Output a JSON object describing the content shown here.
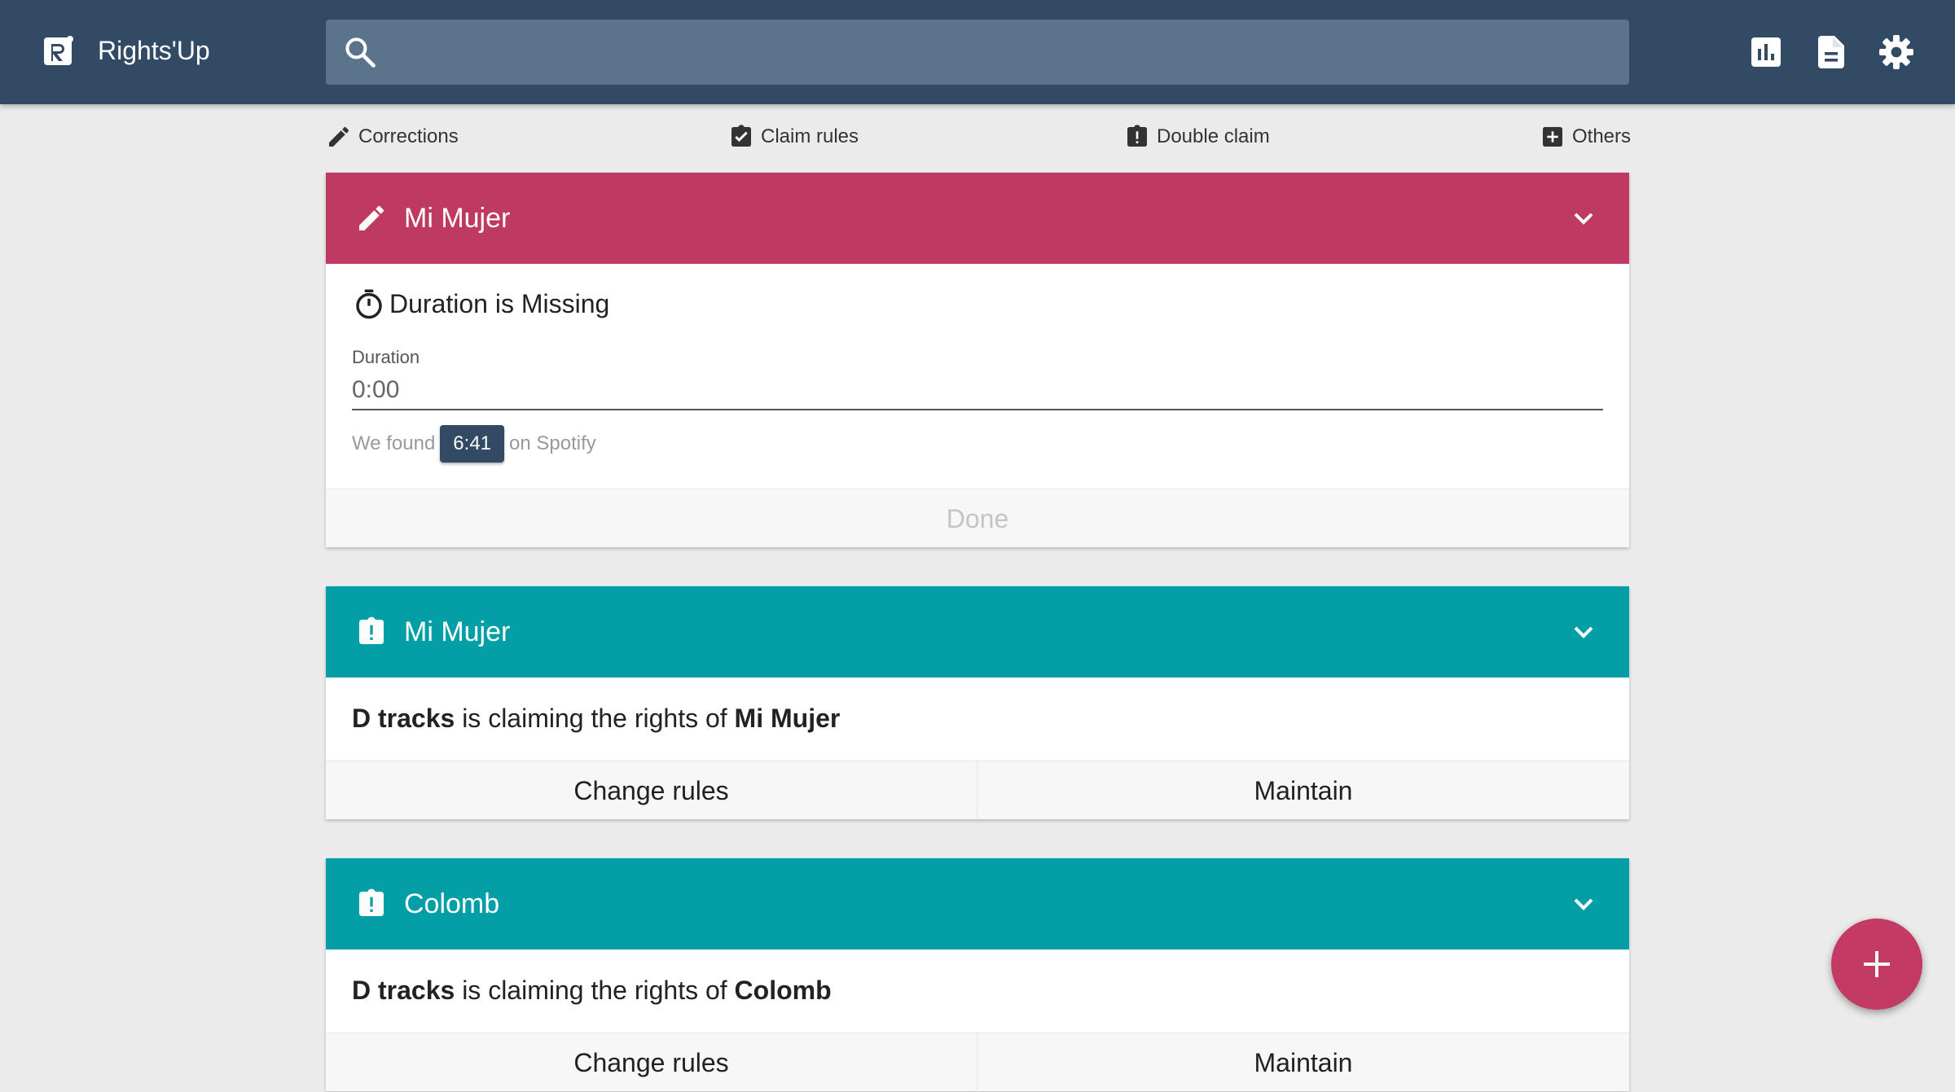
{
  "app": {
    "name": "Rights'Up"
  },
  "search": {
    "placeholder": ""
  },
  "filters": [
    {
      "label": "Corrections",
      "icon": "pencil-icon"
    },
    {
      "label": "Claim rules",
      "icon": "clipboard-check-icon"
    },
    {
      "label": "Double claim",
      "icon": "clipboard-alert-icon"
    },
    {
      "label": "Others",
      "icon": "plus-box-icon"
    }
  ],
  "colors": {
    "appbar": "#324a63",
    "correction": "#bf3a63",
    "claim": "#049ea7",
    "fab": "#c33a65"
  },
  "cards": [
    {
      "type": "correction",
      "title": "Mi Mujer",
      "issue": "Duration is Missing",
      "field_label": "Duration",
      "field_value": "0:00",
      "found_prefix": "We found",
      "found_value": "6:41",
      "found_suffix": "on Spotify",
      "action": "Done"
    },
    {
      "type": "double-claim",
      "title": "Mi Mujer",
      "claimant": "D tracks",
      "claim_middle": "is claiming the rights of",
      "work": "Mi Mujer",
      "actions": [
        "Change rules",
        "Maintain"
      ]
    },
    {
      "type": "double-claim",
      "title": "Colomb",
      "claimant": "D tracks",
      "claim_middle": "is claiming the rights of",
      "work": "Colomb",
      "actions": [
        "Change rules",
        "Maintain"
      ]
    }
  ]
}
